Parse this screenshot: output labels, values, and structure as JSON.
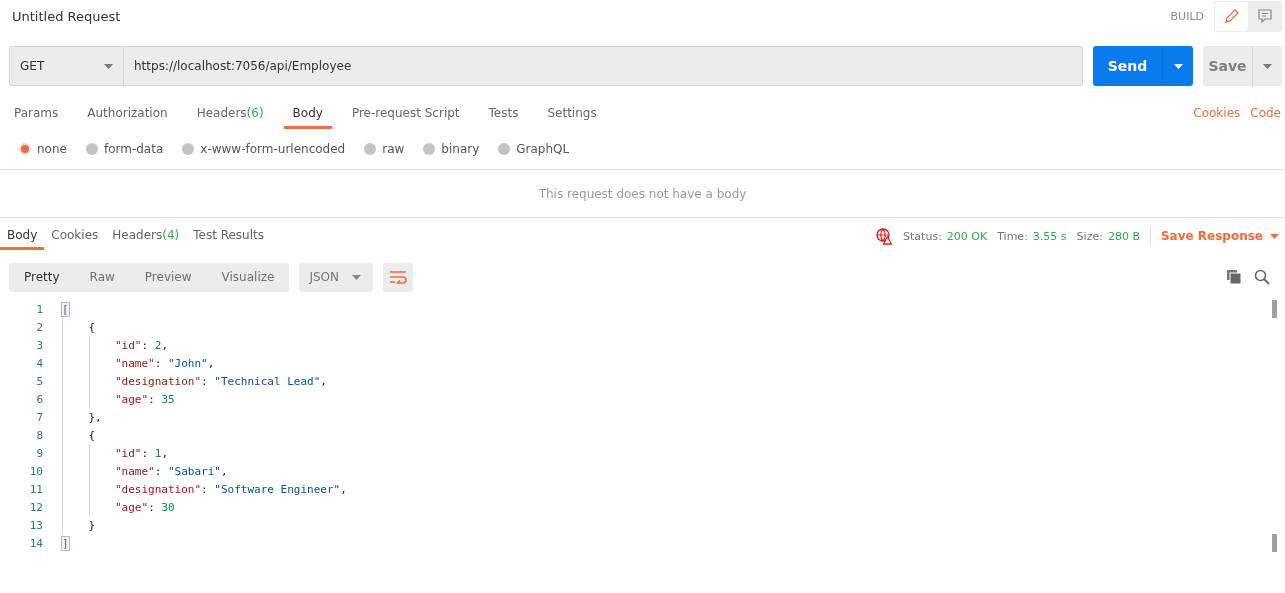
{
  "request": {
    "title": "Untitled Request",
    "mode_label": "BUILD",
    "modes": [
      {
        "kind": "edit",
        "selected": true
      },
      {
        "kind": "comment",
        "selected": false
      }
    ]
  },
  "url_bar": {
    "method": "GET",
    "url": "https://localhost:7056/api/Employee",
    "send_label": "Send",
    "save_label": "Save"
  },
  "request_tabs": [
    {
      "label": "Params",
      "selected": false
    },
    {
      "label": "Authorization",
      "selected": false
    },
    {
      "label": "Headers",
      "count": "(6)",
      "selected": false
    },
    {
      "label": "Body",
      "selected": true
    },
    {
      "label": "Pre-request Script",
      "selected": false
    },
    {
      "label": "Tests",
      "selected": false
    },
    {
      "label": "Settings",
      "selected": false
    }
  ],
  "request_links": [
    "Cookies",
    "Code"
  ],
  "body_types": [
    {
      "label": "none",
      "selected": true
    },
    {
      "label": "form-data",
      "selected": false
    },
    {
      "label": "x-www-form-urlencoded",
      "selected": false
    },
    {
      "label": "raw",
      "selected": false
    },
    {
      "label": "binary",
      "selected": false
    },
    {
      "label": "GraphQL",
      "selected": false
    }
  ],
  "body_message": "This request does not have a body",
  "response_tabs": [
    {
      "label": "Body",
      "selected": true
    },
    {
      "label": "Cookies",
      "selected": false
    },
    {
      "label": "Headers",
      "count": "(4)",
      "selected": false
    },
    {
      "label": "Test Results",
      "selected": false
    }
  ],
  "response_meta": [
    {
      "label": "Status:",
      "value": "200 OK"
    },
    {
      "label": "Time:",
      "value": "3.55 s"
    },
    {
      "label": "Size:",
      "value": "280 B"
    }
  ],
  "save_response": "Save Response",
  "view_modes": [
    {
      "label": "Pretty",
      "selected": true
    },
    {
      "label": "Raw",
      "selected": false
    },
    {
      "label": "Preview",
      "selected": false
    },
    {
      "label": "Visualize",
      "selected": false
    }
  ],
  "format": "JSON",
  "wrap_on": true,
  "code_lines": [
    {
      "number": "1",
      "tokens": [
        {
          "kind": "bracket",
          "text": "[",
          "matched": true
        }
      ],
      "children": [
        {
          "number": "2",
          "tokens": [
            {
              "kind": "punct",
              "text": "{",
              "matched": false
            }
          ],
          "children": [
            {
              "number": "3",
              "tokens": [
                {
                  "kind": "key",
                  "text": "\"id\"",
                  "matched": false
                },
                {
                  "kind": "punct",
                  "text": ": ",
                  "matched": false
                },
                {
                  "kind": "number",
                  "text": "2",
                  "matched": false
                },
                {
                  "kind": "punct",
                  "text": ",",
                  "matched": false
                }
              ]
            },
            {
              "number": "4",
              "tokens": [
                {
                  "kind": "key",
                  "text": "\"name\"",
                  "matched": false
                },
                {
                  "kind": "punct",
                  "text": ": ",
                  "matched": false
                },
                {
                  "kind": "string",
                  "text": "\"John\"",
                  "matched": false
                },
                {
                  "kind": "punct",
                  "text": ",",
                  "matched": false
                }
              ]
            },
            {
              "number": "5",
              "tokens": [
                {
                  "kind": "key",
                  "text": "\"designation\"",
                  "matched": false
                },
                {
                  "kind": "punct",
                  "text": ": ",
                  "matched": false
                },
                {
                  "kind": "string",
                  "text": "\"Technical Lead\"",
                  "matched": false
                },
                {
                  "kind": "punct",
                  "text": ",",
                  "matched": false
                }
              ]
            },
            {
              "number": "6",
              "tokens": [
                {
                  "kind": "key",
                  "text": "\"age\"",
                  "matched": false
                },
                {
                  "kind": "punct",
                  "text": ": ",
                  "matched": false
                },
                {
                  "kind": "number",
                  "text": "35",
                  "matched": false
                }
              ]
            }
          ]
        },
        {
          "number": "7",
          "tokens": [
            {
              "kind": "punct",
              "text": "},",
              "matched": false
            }
          ]
        },
        {
          "number": "8",
          "tokens": [
            {
              "kind": "punct",
              "text": "{",
              "matched": false
            }
          ],
          "children": [
            {
              "number": "9",
              "tokens": [
                {
                  "kind": "key",
                  "text": "\"id\"",
                  "matched": false
                },
                {
                  "kind": "punct",
                  "text": ": ",
                  "matched": false
                },
                {
                  "kind": "number",
                  "text": "1",
                  "matched": false
                },
                {
                  "kind": "punct",
                  "text": ",",
                  "matched": false
                }
              ]
            },
            {
              "number": "10",
              "tokens": [
                {
                  "kind": "key",
                  "text": "\"name\"",
                  "matched": false
                },
                {
                  "kind": "punct",
                  "text": ": ",
                  "matched": false
                },
                {
                  "kind": "string",
                  "text": "\"Sabari\"",
                  "matched": false
                },
                {
                  "kind": "punct",
                  "text": ",",
                  "matched": false
                }
              ]
            },
            {
              "number": "11",
              "tokens": [
                {
                  "kind": "key",
                  "text": "\"designation\"",
                  "matched": false
                },
                {
                  "kind": "punct",
                  "text": ": ",
                  "matched": false
                },
                {
                  "kind": "string",
                  "text": "\"Software Engineer\"",
                  "matched": false
                },
                {
                  "kind": "punct",
                  "text": ",",
                  "matched": false
                }
              ]
            },
            {
              "number": "12",
              "tokens": [
                {
                  "kind": "key",
                  "text": "\"age\"",
                  "matched": false
                },
                {
                  "kind": "punct",
                  "text": ": ",
                  "matched": false
                },
                {
                  "kind": "number",
                  "text": "30",
                  "matched": false
                }
              ]
            }
          ]
        },
        {
          "number": "13",
          "tokens": [
            {
              "kind": "punct",
              "text": "}",
              "matched": false
            }
          ]
        }
      ]
    },
    {
      "number": "14",
      "tokens": [
        {
          "kind": "bracket",
          "text": "]",
          "matched": true
        }
      ]
    }
  ]
}
